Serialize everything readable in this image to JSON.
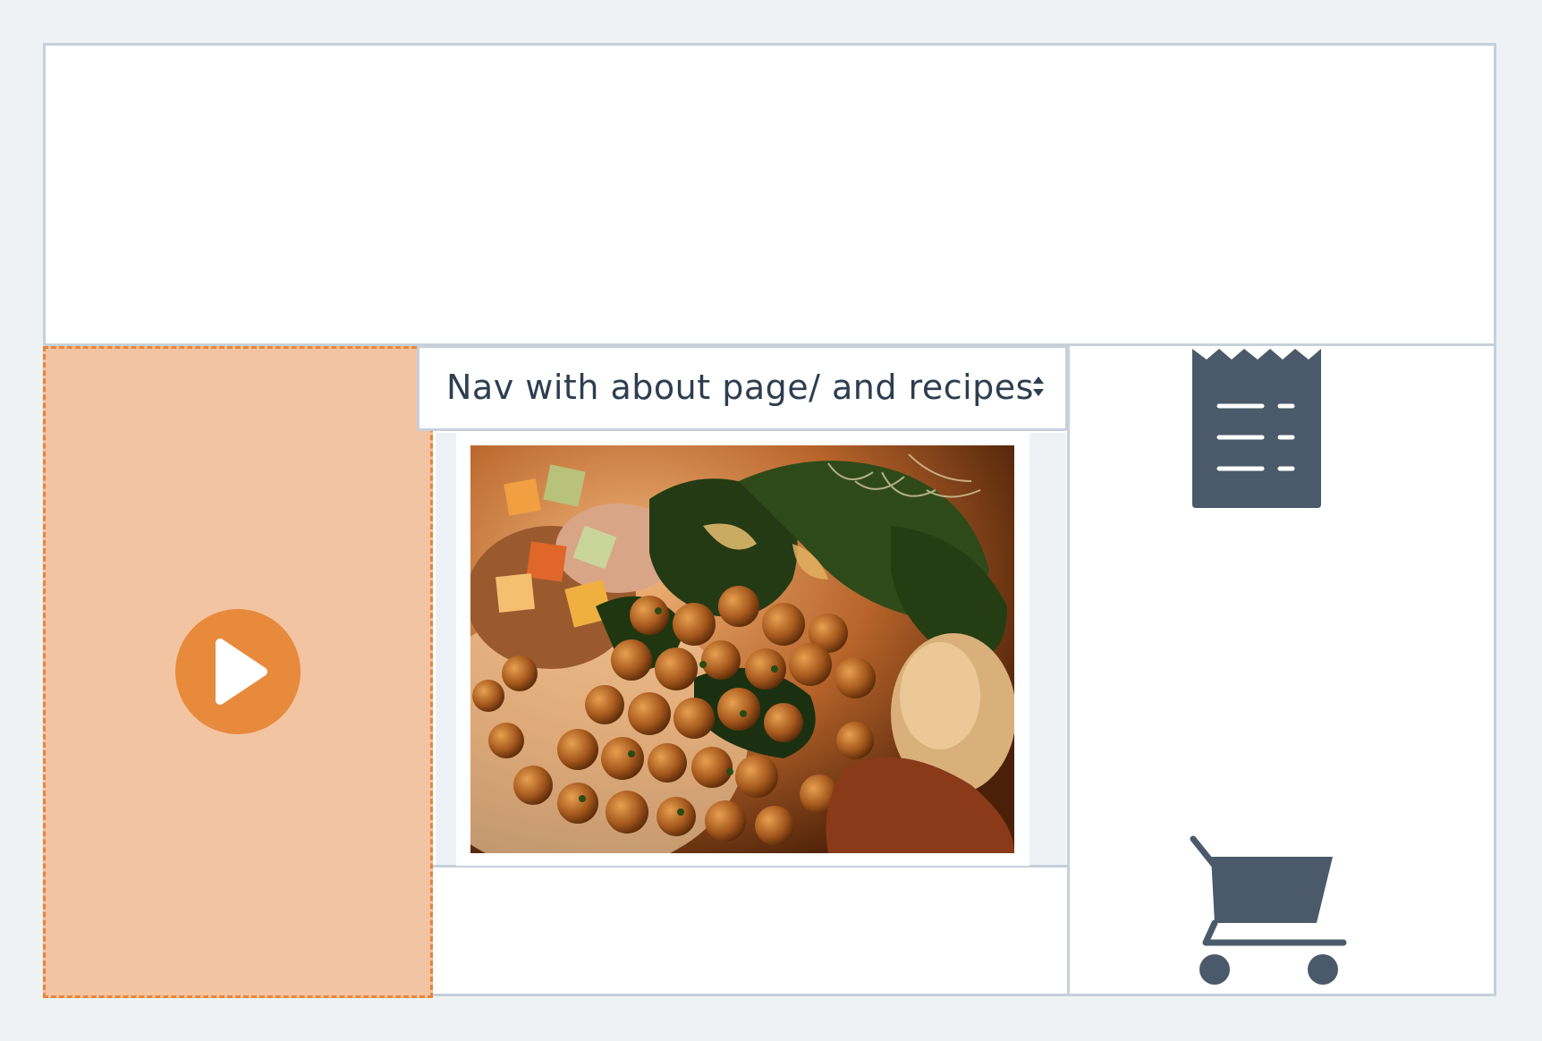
{
  "nav_selector": {
    "selected_label": "Nav with about page/ and recipes"
  },
  "icons": {
    "video": "play-icon",
    "receipt": "receipt-icon",
    "cart": "shopping-cart-icon",
    "select_arrows": "sort-arrows-icon"
  },
  "photo": {
    "subject": "chickpeas-and-greens-plate"
  },
  "colors": {
    "background": "#eef2f5",
    "border": "#c6d0db",
    "accent_orange": "#e88a3c",
    "orange_panel_fill": "#f2c4a1",
    "icon_slate": "#4a5a6a",
    "text": "#2c3e50"
  }
}
